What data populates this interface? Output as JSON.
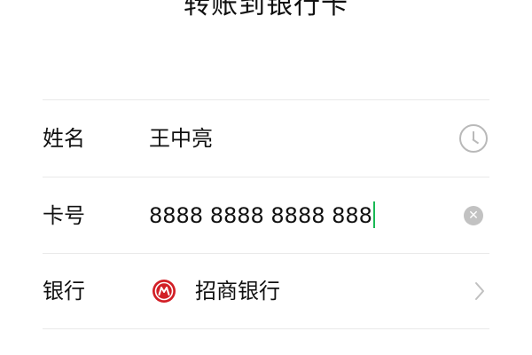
{
  "header": {
    "title": "转账到银行卡"
  },
  "form": {
    "name": {
      "label": "姓名",
      "value": "王中亮",
      "icon": "clock-icon"
    },
    "card": {
      "label": "卡号",
      "value": "8888 8888 8888 888",
      "icon": "clear-icon"
    },
    "bank": {
      "label": "银行",
      "value": "招商银行",
      "icon": "chevron-right-icon",
      "logo": "bank-logo"
    },
    "next": {
      "label": "",
      "value": ""
    }
  },
  "colors": {
    "cursor": "#19b955",
    "bank_logo": "#d21f26",
    "icon_gray": "#b9b9b9"
  }
}
